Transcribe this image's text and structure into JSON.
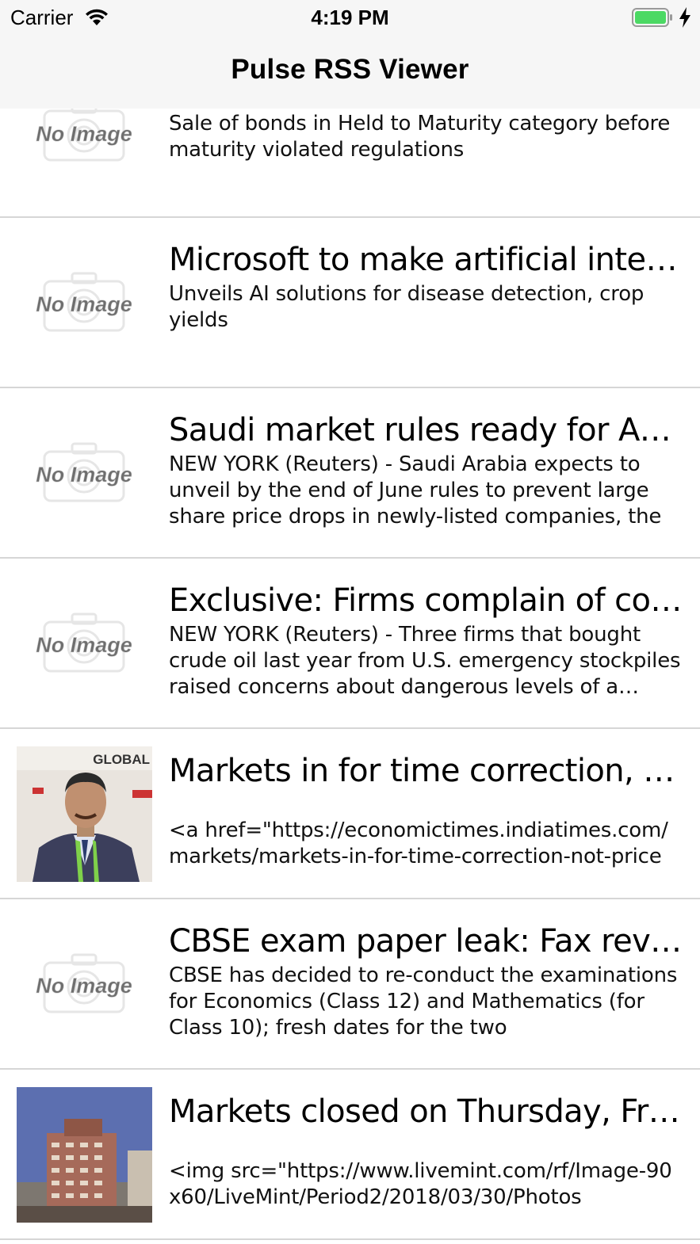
{
  "status": {
    "carrier": "Carrier",
    "time": "4:19 PM"
  },
  "nav": {
    "title": "Pulse RSS Viewer"
  },
  "placeholder_text": "No Image",
  "colors": {
    "battery": "#4cd964",
    "separator": "#d6d6d6",
    "header_bg": "#f6f6f6"
  },
  "items": [
    {
      "title": "",
      "desc": "Sale of bonds in Held to Maturity category before maturity violated regulations",
      "image": "no-image"
    },
    {
      "title": "Microsoft to make artificial intelligence",
      "desc": "Unveils AI solutions for disease detection, crop yields",
      "image": "no-image"
    },
    {
      "title": "Saudi market rules ready for Aramco",
      "desc": "NEW YORK (Reuters) - Saudi Arabia expects to unveil by the end of June rules to prevent large share price drops in newly-listed companies, the",
      "image": "no-image"
    },
    {
      "title": "Exclusive: Firms complain of contaminated",
      "desc": "NEW YORK (Reuters) - Three firms that bought crude oil last year from U.S. emergency stockpiles raised concerns about dangerous levels of a poisonous",
      "image": "no-image"
    },
    {
      "title": "Markets in for time correction, not price",
      "desc": "<a href=\"https://economictimes.indiatimes.com/markets/markets-in-for-time-correction-not-price",
      "image": "photo-person",
      "photo_text": "GLOBAL"
    },
    {
      "title": "CBSE exam paper leak: Fax reveals",
      "desc": "CBSE has decided to re-conduct the examinations for Economics (Class 12) and Mathematics (for Class 10); fresh dates for the two",
      "image": "no-image"
    },
    {
      "title": "Markets closed on Thursday, Friday",
      "desc": "<img src=\"https://www.livemint.com/rf/Image-90x60/LiveMint/Period2/2018/03/30/Photos",
      "image": "photo-building"
    }
  ]
}
